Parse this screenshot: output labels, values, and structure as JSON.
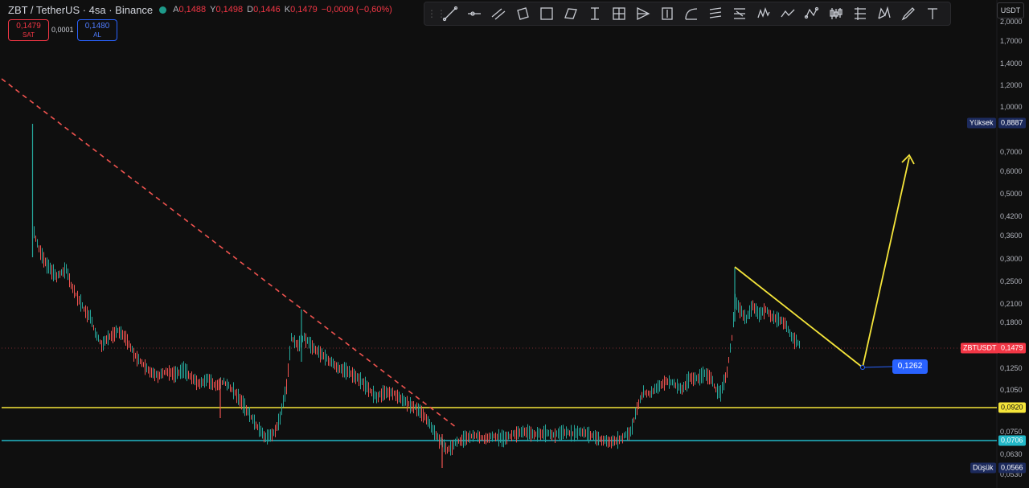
{
  "header": {
    "symbol": "ZBT / TetherUS · 4sa · Binance",
    "ohlc": [
      {
        "label": "A",
        "value": "0,1488"
      },
      {
        "label": "Y",
        "value": "0,1498"
      },
      {
        "label": "D",
        "value": "0,1446"
      },
      {
        "label": "K",
        "value": "0,1479"
      },
      {
        "label": "",
        "value": "−0,0009 (−0,60%)"
      }
    ],
    "sell_price": "0,1479",
    "sell_label": "SAT",
    "spread": "0,0001",
    "buy_price": "0,1480",
    "buy_label": "AL"
  },
  "currency_button": "USDT",
  "toolbar_icons": [
    "trend-line-icon",
    "horizontal-ray-icon",
    "parallel-channel-icon",
    "rotated-rectangle-icon",
    "rectangle-icon",
    "parallelogram-icon",
    "vertical-cursor-icon",
    "cross-line-icon",
    "fib-fan-icon",
    "price-note-icon",
    "arc-icon",
    "fib-retracement-icon",
    "fib-levels-icon",
    "pitchfork-icon",
    "zigzag-icon",
    "pattern-icon",
    "candles-icon",
    "gann-box-icon",
    "xabcd-pattern-icon",
    "brush-icon",
    "text-icon"
  ],
  "price_axis": {
    "labels": [
      "2,0000",
      "1,7000",
      "1,4000",
      "1,2000",
      "1,0000",
      "0,7000",
      "0,6000",
      "0,5000",
      "0,4200",
      "0,3600",
      "0,3000",
      "0,2500",
      "0,2100",
      "0,1800",
      "0,1250",
      "0,1050",
      "0,0750",
      "0,0630",
      "0,0530"
    ],
    "high_label": "Yüksek",
    "high_value": "0,8887",
    "symbol_tag": "ZBTUSDT",
    "current_value": "0,1479",
    "support1_value": "0,0920",
    "support2_value": "0,0706",
    "low_label": "Düşük",
    "low_value": "0,0566"
  },
  "target_label": "0,1262",
  "colors": {
    "background": "#0f0f0f",
    "up": "#26a69a",
    "down": "#ef5350",
    "trendline_red": "#f0534f",
    "yellow": "#f5e53a",
    "cyan": "#22b8c8",
    "blue": "#2962ff",
    "navy": "#1c2a5c"
  }
}
